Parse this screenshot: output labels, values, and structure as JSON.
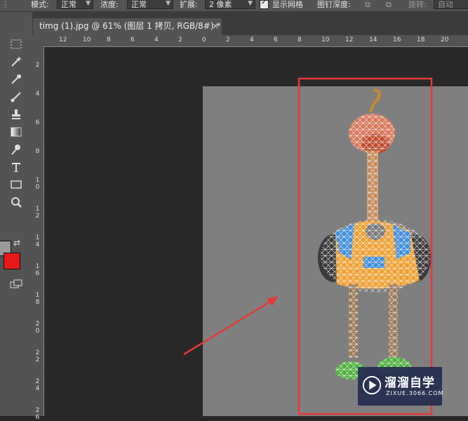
{
  "options_bar": {
    "mode_label": "模式:",
    "mode_value": "正常",
    "density_label": "浓度:",
    "density_value": "正常",
    "expand_label": "扩展:",
    "expand_value": "2 像素",
    "show_mesh_label": "显示网格",
    "layer_depth_label": "图钉深度:",
    "rotate_label": "旋转:",
    "rotate_value": "自动"
  },
  "document_tab": {
    "title": "timg (1).jpg @ 61% (图层 1 拷贝, RGB/8#) *",
    "close": "×"
  },
  "ruler_h": [
    "12",
    "10",
    "8",
    "6",
    "4",
    "2",
    "0",
    "2",
    "4",
    "6",
    "8",
    "10",
    "12",
    "14",
    "16",
    "18",
    "20"
  ],
  "ruler_v": [
    "2",
    "4",
    "6",
    "8",
    "10",
    "12",
    "14",
    "16",
    "18",
    "20",
    "22",
    "24",
    "26"
  ],
  "colors": {
    "foreground": "#9a9a9a",
    "background": "#e8191a",
    "annotation": "#e53935",
    "doc_bg": "#7f7f7f"
  },
  "tools": [
    "marquee-icon",
    "magic-wand-icon",
    "eyedropper-icon",
    "brush-icon",
    "clone-stamp-icon",
    "gradient-icon",
    "smudge-icon",
    "type-icon",
    "rectangle-icon",
    "zoom-icon"
  ],
  "watermark": {
    "title": "溜溜自学",
    "subtitle": "ZIXUE.3066.COM"
  }
}
